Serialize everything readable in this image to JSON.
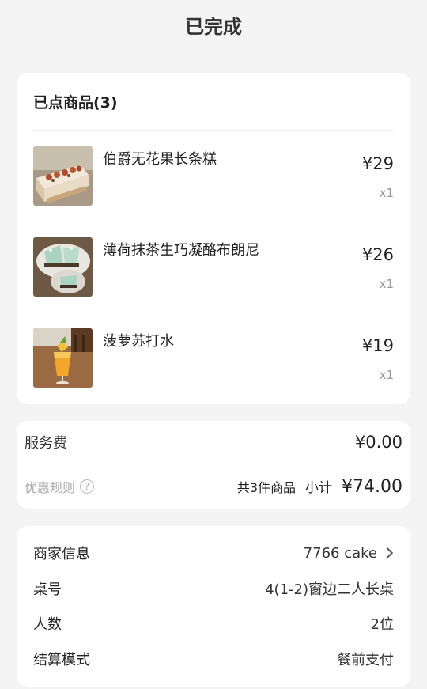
{
  "header": {
    "title": "已完成"
  },
  "items_section": {
    "title": "已点商品(3)",
    "items": [
      {
        "name": "伯爵无花果长条糕",
        "price": "¥29",
        "qty": "x1",
        "icon": "cake-photo"
      },
      {
        "name": "薄荷抹茶生巧凝酪布朗尼",
        "price": "¥26",
        "qty": "x1",
        "icon": "brownie-photo"
      },
      {
        "name": "菠萝苏打水",
        "price": "¥19",
        "qty": "x1",
        "icon": "drink-photo"
      }
    ]
  },
  "fees": {
    "service_label": "服务费",
    "service_value": "¥0.00",
    "discount_label": "优惠规则",
    "count_text": "共3件商品",
    "subtotal_label": "小计",
    "subtotal_value": "¥74.00"
  },
  "info": {
    "merchant_label": "商家信息",
    "merchant_value": "7766 cake",
    "table_label": "桌号",
    "table_value": "4(1-2)窗边二人长桌",
    "people_label": "人数",
    "people_value": "2位",
    "settle_label": "结算模式",
    "settle_value": "餐前支付"
  }
}
